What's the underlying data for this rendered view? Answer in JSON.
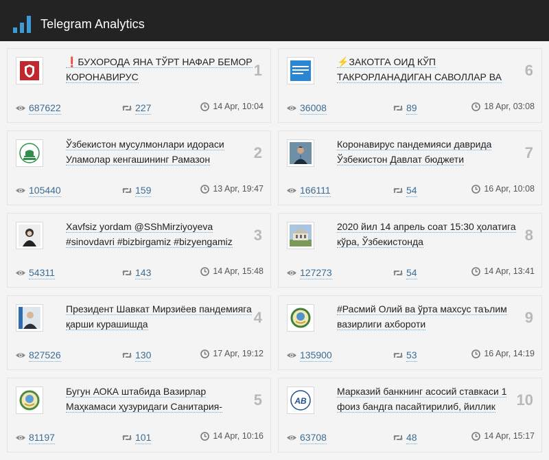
{
  "header": {
    "title": "Telegram Analytics"
  },
  "posts": [
    {
      "rank": "1",
      "text": "❗️БУХОРОДА ЯНА ТЎРТ НАФАР БЕМОР КОРОНАВИРУС",
      "views": "687622",
      "reposts": "227",
      "time": "14 Apr, 10:04",
      "thumb": "red-emblem-icon"
    },
    {
      "rank": "2",
      "text": "Ўзбекистон мусулмонлари идораси Уламолар кенгашининг Рамазон",
      "views": "105440",
      "reposts": "159",
      "time": "13 Apr, 19:47",
      "thumb": "muslim-board-logo-icon"
    },
    {
      "rank": "3",
      "text": "Xavfsiz yordam @SShMirziyoyeva #sinovdavri #bizbirgamiz #bizyengamiz",
      "views": "54311",
      "reposts": "143",
      "time": "14 Apr, 15:48",
      "thumb": "woman-portrait-icon"
    },
    {
      "rank": "4",
      "text": "Президент Шавкат Мирзиёев пандемияга қарши курашишда",
      "views": "827526",
      "reposts": "130",
      "time": "17 Apr, 19:12",
      "thumb": "president-portrait-icon"
    },
    {
      "rank": "5",
      "text": "Бугун АОКА штабида Вазирлар Маҳкамаси ҳузуридаги Санитария-",
      "views": "81197",
      "reposts": "101",
      "time": "14 Apr, 10:16",
      "thumb": "state-emblem-icon"
    },
    {
      "rank": "6",
      "text": "⚡️ЗАКОТГА ОИД КЎП ТАКРОРЛАНАДИГАН САВОЛЛАР ВА",
      "views": "36008",
      "reposts": "89",
      "time": "18 Apr, 03:08",
      "thumb": "blue-banner-icon"
    },
    {
      "rank": "7",
      "text": "Коронавирус пандемияси даврида Ўзбекистон Давлат бюджети",
      "views": "166111",
      "reposts": "54",
      "time": "16 Apr, 10:08",
      "thumb": "man-portrait-icon"
    },
    {
      "rank": "8",
      "text": "2020 йил 14 апрель соат 15:30 ҳолатига кўра, Ўзбекистонда",
      "views": "127273",
      "reposts": "54",
      "time": "14 Apr, 13:41",
      "thumb": "building-photo-icon"
    },
    {
      "rank": "9",
      "text": "#Расмий Олий ва ўрта махсус таълим вазирлиги ахбороти",
      "views": "135900",
      "reposts": "53",
      "time": "16 Apr, 14:19",
      "thumb": "state-emblem-icon"
    },
    {
      "rank": "10",
      "text": "Марказий банкнинг асосий ставкаси 1 фоиз бандга пасайтирилиб, йиллик",
      "views": "63708",
      "reposts": "48",
      "time": "14 Apr, 15:17",
      "thumb": "bank-logo-icon"
    }
  ],
  "colors": {
    "accent": "#3d9ad8",
    "header_bg": "#232323",
    "rank": "#b8b8b8"
  }
}
